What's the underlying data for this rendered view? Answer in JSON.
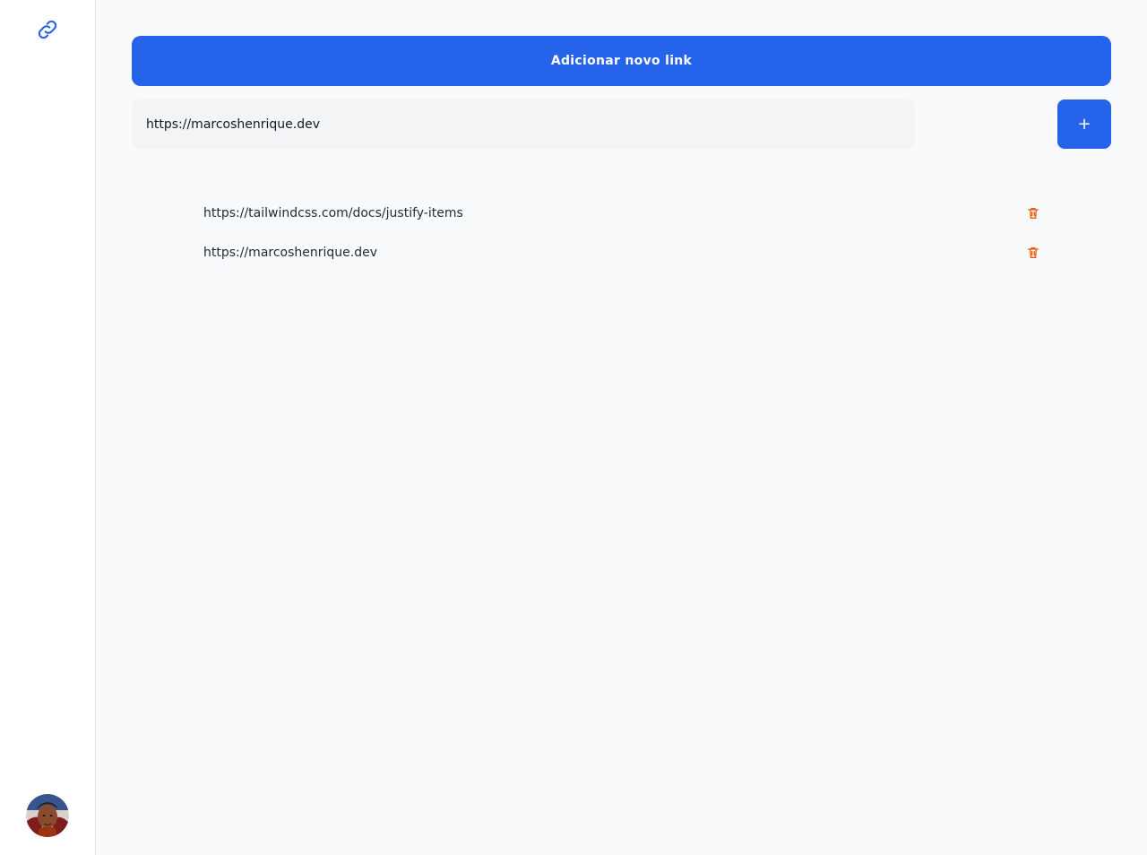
{
  "sidebar": {
    "logo_icon": "link-icon",
    "avatar_icon": "user-avatar"
  },
  "main": {
    "add_link_label": "Adicionar novo link",
    "url_input_value": "https://marcoshenrique.dev",
    "add_button_label": "+",
    "links": [
      {
        "url": "https://tailwindcss.com/docs/justify-items",
        "delete_icon": "trash-icon"
      },
      {
        "url": "https://marcoshenrique.dev",
        "delete_icon": "trash-icon"
      }
    ]
  },
  "colors": {
    "accent": "#2563eb",
    "delete": "#ea580c",
    "background": "#f8fafc",
    "sidebar": "#ffffff",
    "input": "#f3f4f6"
  }
}
